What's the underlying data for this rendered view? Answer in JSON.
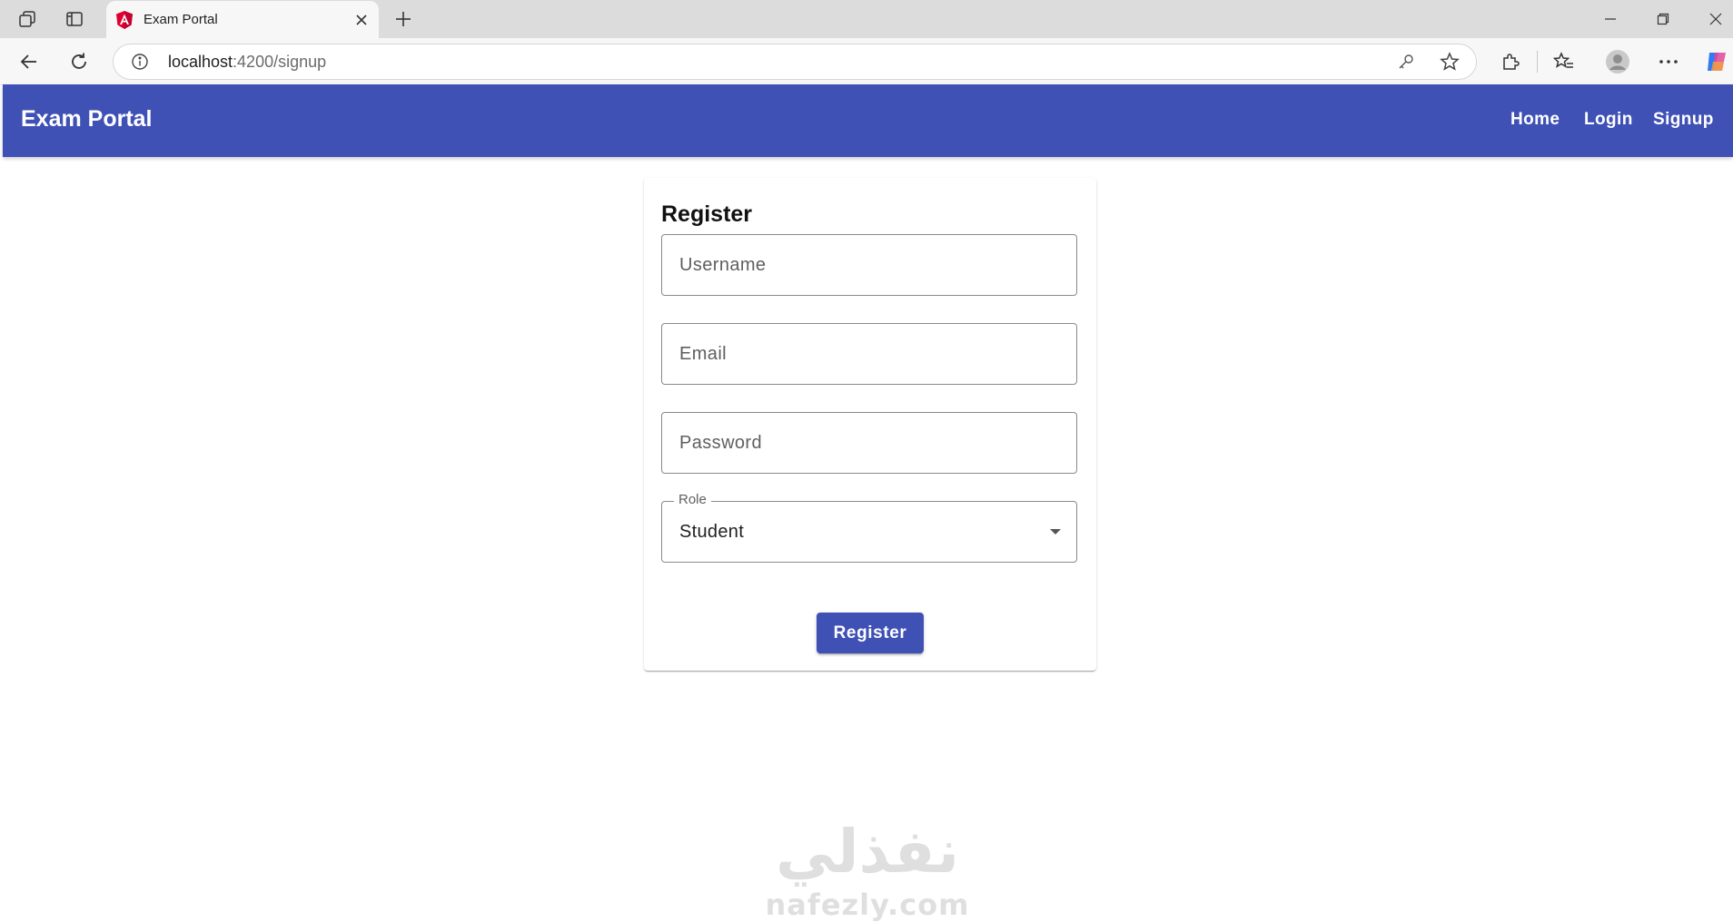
{
  "browser": {
    "tab": {
      "title": "Exam Portal"
    },
    "url": {
      "host": "localhost",
      "path": ":4200/signup"
    }
  },
  "nav": {
    "brand": "Exam Portal",
    "links": [
      "Home",
      "Login",
      "Signup"
    ]
  },
  "form": {
    "title": "Register",
    "username_placeholder": "Username",
    "email_placeholder": "Email",
    "password_placeholder": "Password",
    "role_label": "Role",
    "role_value": "Student",
    "submit_label": "Register"
  },
  "watermark": {
    "arabic": "نفذلي",
    "latin": "nafezly.com"
  },
  "colors": {
    "primary": "#3f51b5",
    "background": "#ffffff"
  }
}
